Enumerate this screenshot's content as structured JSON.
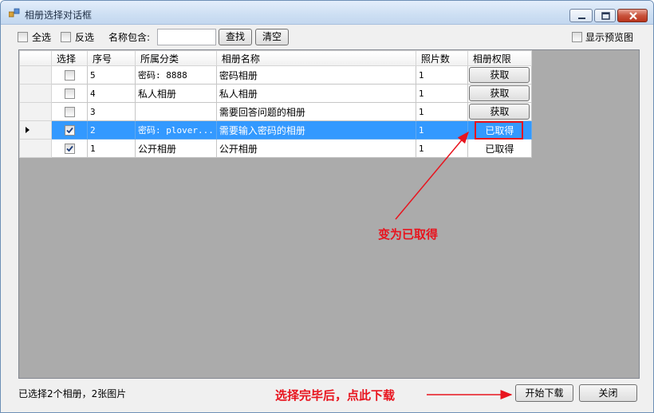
{
  "window": {
    "title": "相册选择对话框"
  },
  "toolbar": {
    "select_all_label": "全选",
    "invert_label": "反选",
    "name_contains_label": "名称包含:",
    "name_filter_value": "",
    "search_button": "查找",
    "clear_button": "清空",
    "show_preview_label": "显示预览图"
  },
  "grid": {
    "columns": [
      "选择",
      "序号",
      "所属分类",
      "相册名称",
      "照片数",
      "相册权限"
    ],
    "rows": [
      {
        "selected": false,
        "checked": false,
        "index": "5",
        "category": "密码: 8888",
        "name": "密码相册",
        "count": "1",
        "permission": "获取",
        "permission_is_button": true
      },
      {
        "selected": false,
        "checked": false,
        "index": "4",
        "category": "私人相册",
        "name": "私人相册",
        "count": "1",
        "permission": "获取",
        "permission_is_button": true
      },
      {
        "selected": false,
        "checked": false,
        "index": "3",
        "category": "",
        "name": "需要回答问题的相册",
        "count": "1",
        "permission": "获取",
        "permission_is_button": true
      },
      {
        "selected": true,
        "checked": true,
        "index": "2",
        "category": "密码: plover...",
        "name": "需要输入密码的相册",
        "count": "1",
        "permission": "已取得",
        "permission_is_button": false
      },
      {
        "selected": false,
        "checked": true,
        "index": "1",
        "category": "公开相册",
        "name": "公开相册",
        "count": "1",
        "permission": "已取得",
        "permission_is_button": false
      }
    ]
  },
  "annotations": {
    "became_obtained": "变为已取得",
    "click_download": "选择完毕后，点此下载"
  },
  "footer": {
    "status_text": "已选择2个相册，2张图片",
    "start_download_button": "开始下载",
    "close_button": "关闭"
  },
  "colors": {
    "selection": "#3399ff",
    "annotation": "#e8141e",
    "grid_background": "#ababab"
  }
}
